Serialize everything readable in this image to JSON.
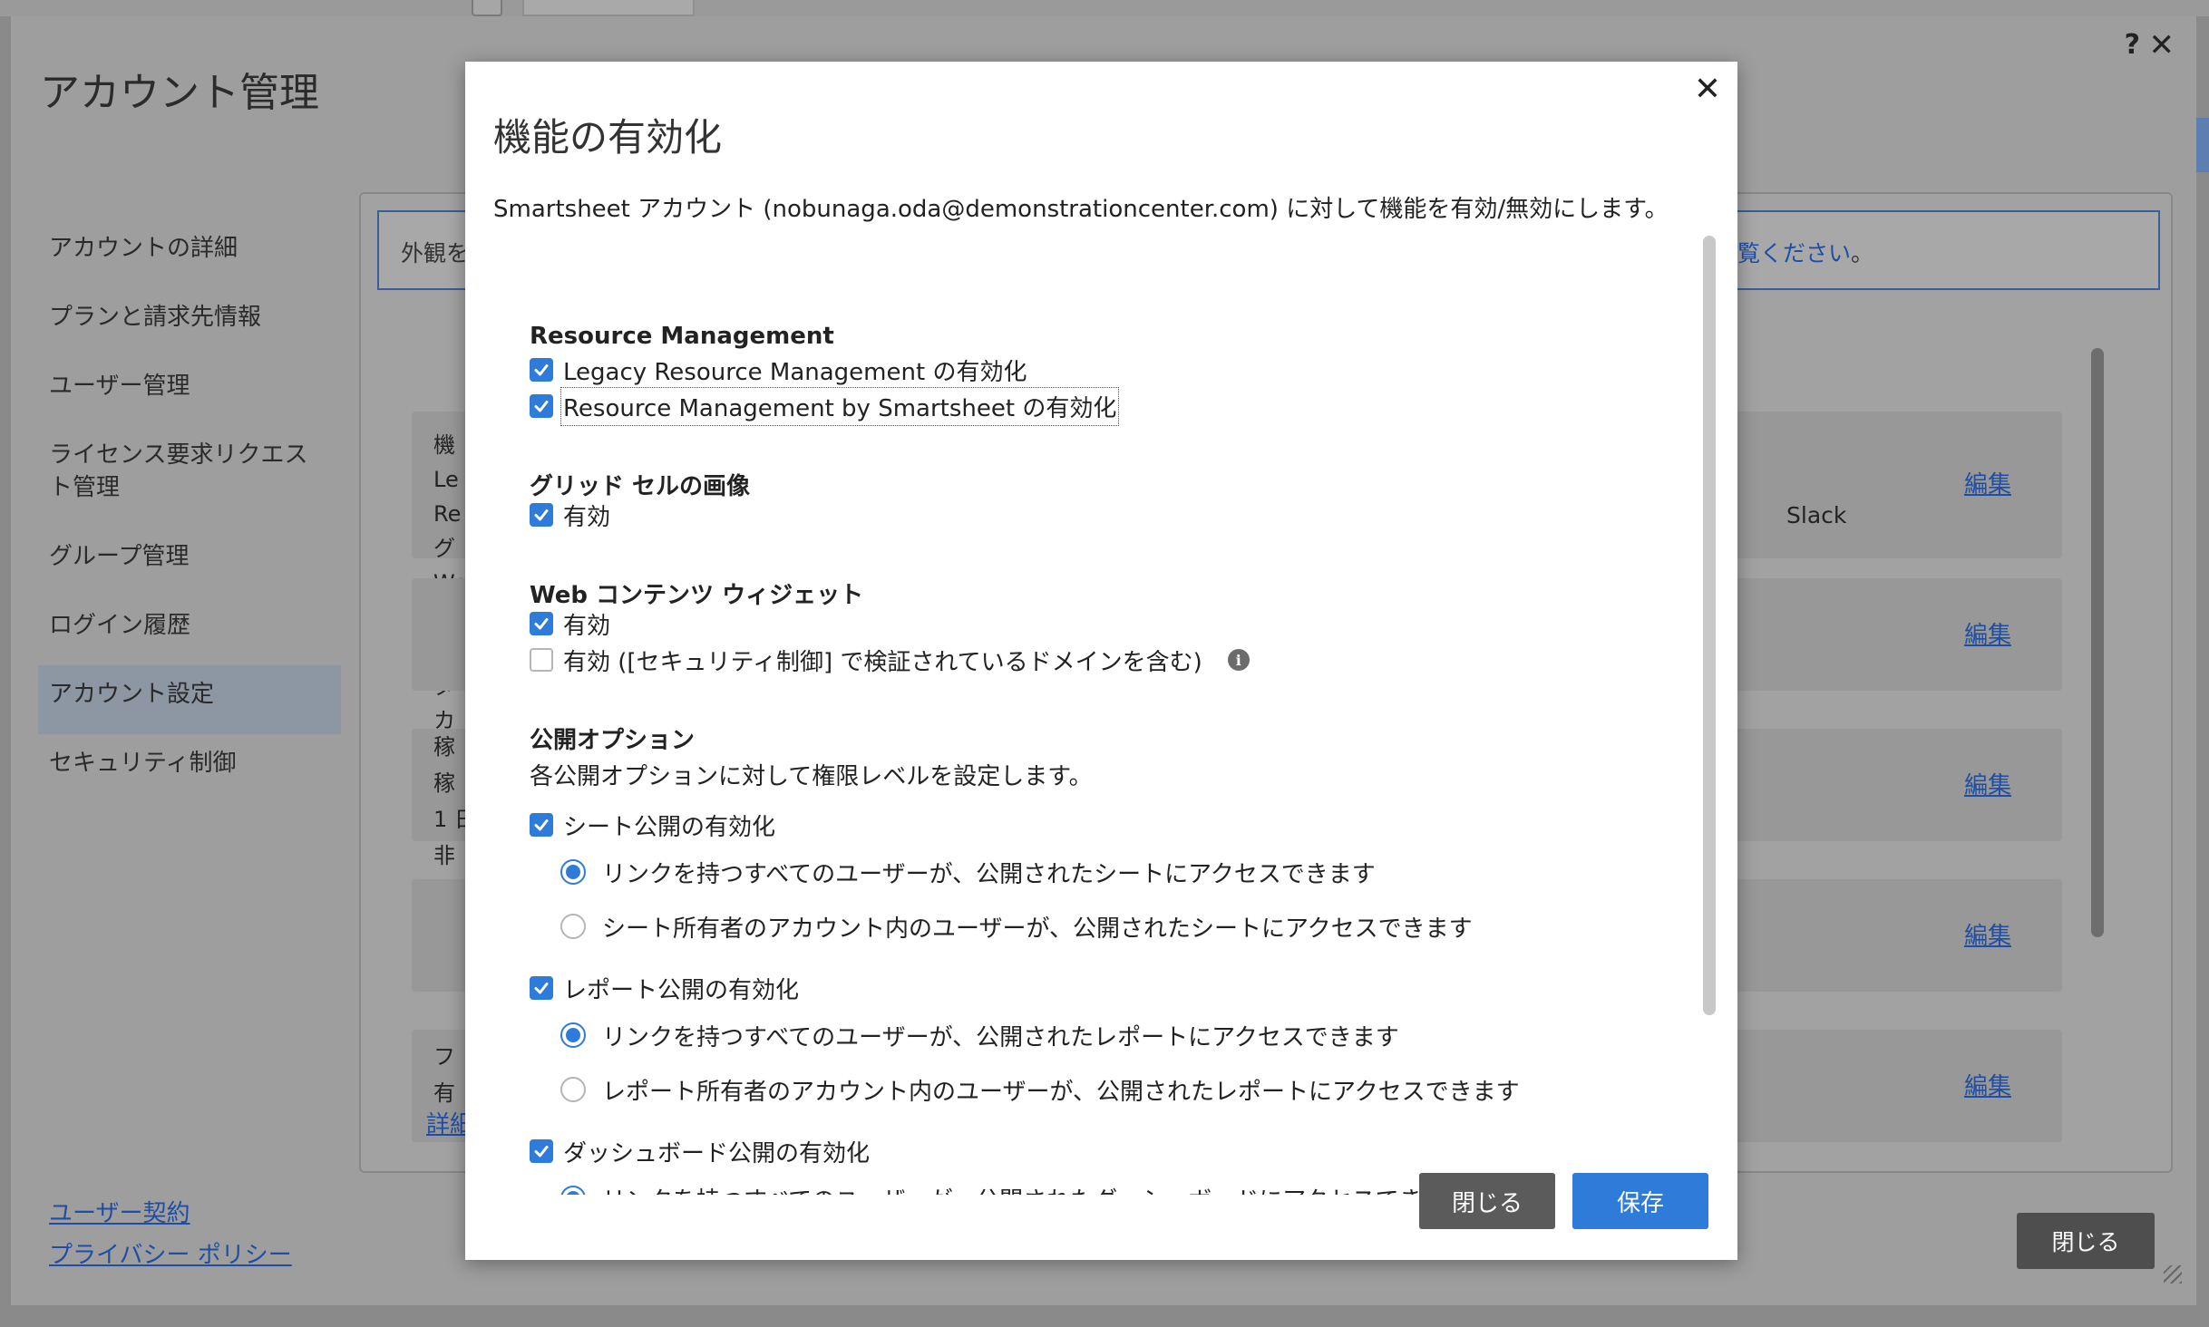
{
  "background": {
    "title": "アカウント管理",
    "help_icon": "?",
    "close_icon": "✕",
    "nav": [
      {
        "label": "アカウントの詳細"
      },
      {
        "label": "プランと請求先情報"
      },
      {
        "label": "ユーザー管理"
      },
      {
        "label": "ライセンス要求リクエスト管理"
      },
      {
        "label": "グループ管理"
      },
      {
        "label": "ログイン履歴"
      },
      {
        "label": "アカウント設定"
      },
      {
        "label": "セキュリティ制御"
      }
    ],
    "footer_links": [
      "ユーザー契約",
      "プライバシー ポリシー"
    ],
    "banner_left": "外観を",
    "banner_right_link": "覧ください",
    "banner_right_end": "。",
    "cards": [
      {
        "text": "機\nLe\nRe\nグ\nWe\nシー\nレ\nダ\nカ",
        "edit": "編集",
        "extra": "Slack"
      },
      {
        "text": "",
        "edit": "編集"
      },
      {
        "text": "稼\n稼\n1 日\n非",
        "edit": "編集"
      },
      {
        "text": "",
        "edit": "編集"
      },
      {
        "text": "フ\n有",
        "edit": "編集"
      }
    ],
    "detail_link": "詳細",
    "close_button": "閉じる"
  },
  "modal": {
    "title": "機能の有効化",
    "description": "Smartsheet アカウント (nobunaga.oda@demonstrationcenter.com) に対して機能を有効/無効にします。",
    "close_icon": "✕",
    "sections": {
      "resource": {
        "title": "Resource Management",
        "options": [
          {
            "label": "Legacy Resource Management の有効化",
            "checked": true
          },
          {
            "label": "Resource Management by Smartsheet の有効化",
            "checked": true
          }
        ]
      },
      "grid": {
        "title": "グリッド セルの画像",
        "options": [
          {
            "label": "有効",
            "checked": true
          }
        ]
      },
      "web": {
        "title": "Web コンテンツ ウィジェット",
        "options": [
          {
            "label": "有効",
            "checked": true
          },
          {
            "label": "有効 ([セキュリティ制御] で検証されているドメインを含む)",
            "checked": false
          }
        ],
        "info_icon": "i"
      },
      "publish": {
        "title": "公開オプション",
        "subtitle": "各公開オプションに対して権限レベルを設定します。",
        "sheet": {
          "label": "シート公開の有効化",
          "checked": true,
          "radios": [
            {
              "label": "リンクを持つすべてのユーザーが、公開されたシートにアクセスできます",
              "selected": true
            },
            {
              "label": "シート所有者のアカウント内のユーザーが、公開されたシートにアクセスできます",
              "selected": false
            }
          ]
        },
        "report": {
          "label": "レポート公開の有効化",
          "checked": true,
          "radios": [
            {
              "label": "リンクを持つすべてのユーザーが、公開されたレポートにアクセスできます",
              "selected": true
            },
            {
              "label": "レポート所有者のアカウント内のユーザーが、公開されたレポートにアクセスできます",
              "selected": false
            }
          ]
        },
        "dashboard": {
          "label": "ダッシュボード公開の有効化",
          "checked": true,
          "radios": [
            {
              "label": "リンクを持つすべてのユーザーが、公開されたダッシュボードにアクセスできます",
              "selected": true
            }
          ]
        }
      }
    },
    "buttons": {
      "close": "閉じる",
      "save": "保存"
    },
    "accent_color": "#2f7bd9"
  }
}
